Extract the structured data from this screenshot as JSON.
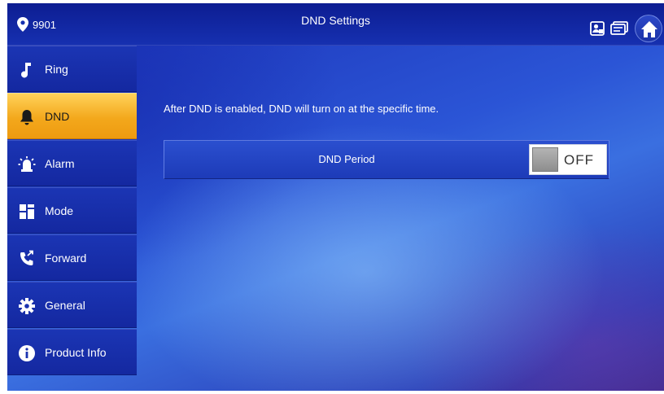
{
  "header": {
    "room_number": "9901",
    "title": "DND Settings",
    "icons": [
      "location-pin-icon",
      "monitor-status-icon",
      "message-icon",
      "home-icon"
    ]
  },
  "sidebar": {
    "items": [
      {
        "id": "ring",
        "label": "Ring",
        "icon": "music-note-icon",
        "active": false
      },
      {
        "id": "dnd",
        "label": "DND",
        "icon": "bell-icon",
        "active": true
      },
      {
        "id": "alarm",
        "label": "Alarm",
        "icon": "alarm-siren-icon",
        "active": false
      },
      {
        "id": "mode",
        "label": "Mode",
        "icon": "grid-icon",
        "active": false
      },
      {
        "id": "forward",
        "label": "Forward",
        "icon": "call-forward-icon",
        "active": false
      },
      {
        "id": "general",
        "label": "General",
        "icon": "gear-icon",
        "active": false
      },
      {
        "id": "product-info",
        "label": "Product Info",
        "icon": "info-icon",
        "active": false
      }
    ]
  },
  "main": {
    "description": "After DND is enabled, DND will turn on at the specific time.",
    "dnd_period": {
      "label": "DND Period",
      "toggle_state": "OFF"
    }
  },
  "colors": {
    "header_bg": "#1630b0",
    "nav_bg": "#1a32b0",
    "nav_active": "#f3a81c",
    "background": "#2b55d6",
    "toggle_knob": "#9a9a9a"
  }
}
